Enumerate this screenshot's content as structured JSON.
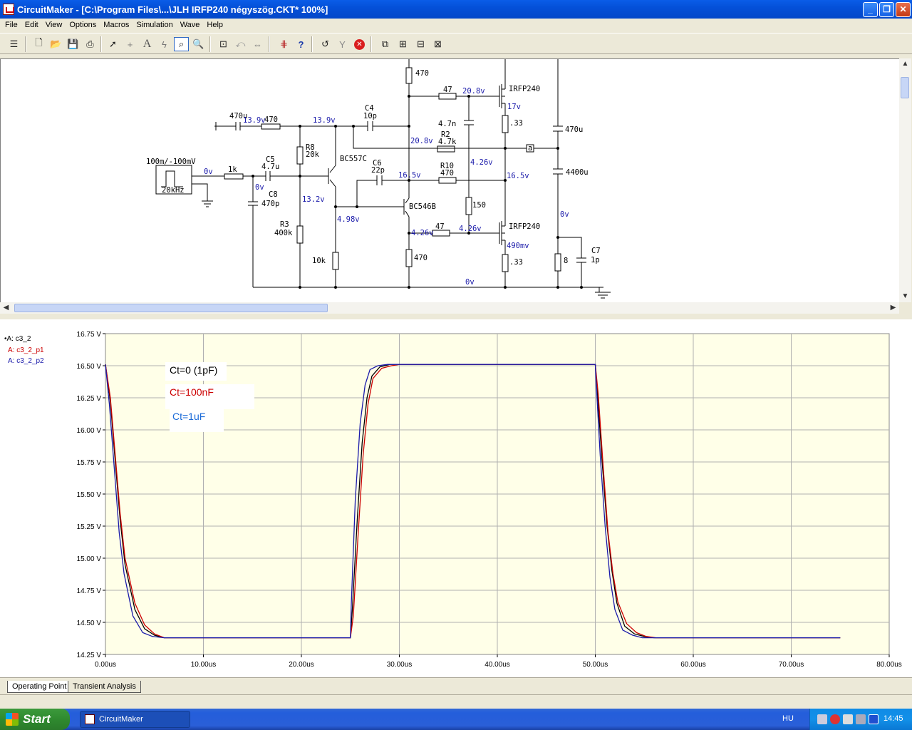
{
  "window": {
    "title": "CircuitMaker - [C:\\Program Files\\...\\JLH IRFP240 négyszög.CKT* 100%]"
  },
  "window_controls": {
    "minimize": "_",
    "maximize": "❐",
    "close": "✕"
  },
  "menu": [
    "File",
    "Edit",
    "View",
    "Options",
    "Macros",
    "Simulation",
    "Wave",
    "Help"
  ],
  "toolbar": {
    "icons": [
      "probe-tool-icon",
      "new-file-icon",
      "open-file-icon",
      "save-icon",
      "print-icon",
      "arrow-tool-icon",
      "wire-tool-icon",
      "text-tool-icon",
      "lightning-tool-icon",
      "probe-icon",
      "zoom-icon",
      "zoom-fit-icon",
      "rotate-icon",
      "mirror-icon",
      "digital-probe-icon",
      "help-icon",
      "reset-icon",
      "step-icon",
      "stop-icon",
      "device-icon",
      "trace-icon",
      "scope-icon",
      "analysis-icon"
    ]
  },
  "schematic": {
    "source": {
      "label": "100m/-100mV",
      "freq": "20kHz"
    },
    "labels": {
      "in_v": "0v",
      "r_1k": "1k",
      "c_470u": "470u",
      "r_470_in": "470",
      "v_13_9a": "13.9v",
      "v_13_9b": "13.9v",
      "c5": "C5",
      "c5_val": "4.7u",
      "r8": "R8",
      "r8_val": "20k",
      "r3": "R3",
      "r3_val": "400k",
      "c8": "C8",
      "c8_val": "470p",
      "v0_c8": "0v",
      "v13_2": "13.2v",
      "q1": "BC557C",
      "v4_98": "4.98v",
      "r_10k": "10k",
      "c4": "C4",
      "c4_val": "10p",
      "c6": "C6",
      "c6_val": "22p",
      "v16_5a": "16.5v",
      "q2": "BC546B",
      "v4_26a": "4.26v",
      "r470_top": "470",
      "r470_bot": "470",
      "r47_top": "47",
      "r47_bot": "47",
      "v20_8a": "20.8v",
      "v20_8b": "20.8v",
      "c_4_7n": "4.7n",
      "r2": "R2",
      "r2_val": "4.7k",
      "r10": "R10",
      "r10_val": "470",
      "v4_26b": "4.26v",
      "v4_26c": "4.26v",
      "r150": "150",
      "m1": "IRFP240",
      "m2": "IRFP240",
      "v17": "17v",
      "v16_5b": "16.5v",
      "v490": "490mv",
      "r33_top": ".33",
      "r33_bot": ".33",
      "c_out_470u": "470u",
      "c_4400u": "4400u",
      "v0_out": "0v",
      "r8_load": "8",
      "c7": "C7",
      "c7_val": "1p",
      "v0_gnd": "0v",
      "probe": "a"
    }
  },
  "graph": {
    "legend": [
      {
        "label": "A: c3_2",
        "color": "#000000",
        "marker": "•"
      },
      {
        "label": "A: c3_2_p1",
        "color": "#cc0000",
        "marker": ""
      },
      {
        "label": "A: c3_2_p2",
        "color": "#1a1aaa",
        "marker": ""
      }
    ],
    "annotations": [
      {
        "text": "Ct=0 (1pF)",
        "color": "#000000"
      },
      {
        "text": "Ct=100nF",
        "color": "#cc0000"
      },
      {
        "text": "Ct=1uF",
        "color": "#1a6ad8"
      }
    ]
  },
  "chart_data": {
    "type": "line",
    "title": "",
    "xlabel": "",
    "ylabel": "",
    "xlim": [
      0,
      80
    ],
    "ylim": [
      14.25,
      16.75
    ],
    "x_unit": "us",
    "y_unit": "V",
    "x_ticks": [
      "0.00us",
      "10.00us",
      "20.00us",
      "30.00us",
      "40.00us",
      "50.00us",
      "60.00us",
      "70.00us",
      "80.00us"
    ],
    "y_ticks": [
      "16.75 V",
      "16.50 V",
      "16.25 V",
      "16.00 V",
      "15.75 V",
      "15.50 V",
      "15.25 V",
      "15.00 V",
      "14.75 V",
      "14.50 V",
      "14.25 V"
    ],
    "grid": true,
    "series": [
      {
        "name": "A: c3_2",
        "color": "#000000",
        "x": [
          0,
          0.5,
          1,
          1.5,
          2,
          3,
          4,
          5,
          6,
          25,
          25.2,
          25.7,
          26.2,
          26.7,
          27.2,
          28,
          29,
          30,
          50,
          50.2,
          50.7,
          51.2,
          51.7,
          52.2,
          53,
          54,
          55,
          56,
          75
        ],
        "y": [
          16.51,
          16.22,
          15.75,
          15.3,
          14.95,
          14.6,
          14.45,
          14.4,
          14.38,
          14.38,
          14.6,
          15.3,
          15.9,
          16.25,
          16.42,
          16.49,
          16.51,
          16.51,
          16.51,
          16.3,
          15.75,
          15.25,
          14.9,
          14.65,
          14.47,
          14.41,
          14.39,
          14.38,
          14.38
        ]
      },
      {
        "name": "A: c3_2_p1",
        "color": "#cc0000",
        "x": [
          0,
          0.5,
          1,
          1.5,
          2,
          3,
          4,
          5,
          6,
          25,
          25.3,
          25.8,
          26.3,
          26.8,
          27.3,
          28.2,
          29.2,
          30,
          50,
          50.3,
          50.8,
          51.3,
          51.8,
          52.3,
          53.2,
          54.2,
          55.2,
          56.2,
          75
        ],
        "y": [
          16.51,
          16.25,
          15.8,
          15.35,
          15.0,
          14.65,
          14.48,
          14.41,
          14.38,
          14.38,
          14.55,
          15.2,
          15.8,
          16.2,
          16.4,
          16.48,
          16.5,
          16.51,
          16.51,
          16.28,
          15.72,
          15.2,
          14.88,
          14.66,
          14.49,
          14.42,
          14.39,
          14.38,
          14.38
        ]
      },
      {
        "name": "A: c3_2_p2",
        "color": "#1a1aaa",
        "x": [
          0,
          0.4,
          0.9,
          1.4,
          1.9,
          2.8,
          3.8,
          4.8,
          6,
          25,
          25.1,
          25.5,
          26,
          26.5,
          27,
          27.8,
          28.8,
          30,
          50,
          50.1,
          50.5,
          51,
          51.5,
          52,
          52.8,
          53.8,
          54.8,
          56,
          75
        ],
        "y": [
          16.51,
          16.2,
          15.7,
          15.2,
          14.88,
          14.55,
          14.42,
          14.39,
          14.38,
          14.38,
          14.65,
          15.45,
          16.05,
          16.35,
          16.47,
          16.5,
          16.51,
          16.51,
          16.51,
          16.35,
          15.8,
          15.25,
          14.85,
          14.6,
          14.44,
          14.4,
          14.38,
          14.38,
          14.38
        ]
      }
    ]
  },
  "tabs": [
    "Operating Point",
    "Transient Analysis"
  ],
  "taskbar": {
    "start": "Start",
    "app": "CircuitMaker",
    "lang": "HU",
    "clock": "14:45"
  }
}
